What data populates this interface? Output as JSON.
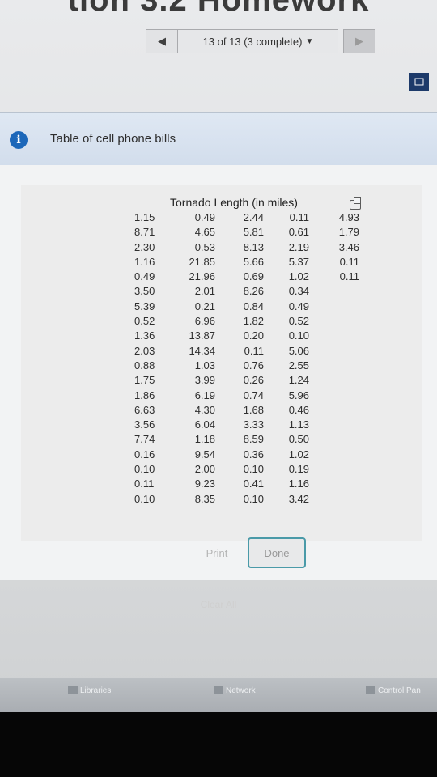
{
  "page": {
    "heading": "tion 3.2 Homework"
  },
  "navigation": {
    "progress_label": "13 of 13 (3 complete)",
    "caret": "▼",
    "prev_glyph": "◀",
    "next_glyph": "▶"
  },
  "dialog": {
    "icon": "info-icon",
    "title": "Table of cell phone bills",
    "table_title": "Tornado Length (in miles)",
    "rows": [
      [
        "1.15",
        "0.49",
        "2.44",
        "0.11",
        "4.93"
      ],
      [
        "8.71",
        "4.65",
        "5.81",
        "0.61",
        "1.79"
      ],
      [
        "2.30",
        "0.53",
        "8.13",
        "2.19",
        "3.46"
      ],
      [
        "1.16",
        "21.85",
        "5.66",
        "5.37",
        "0.11"
      ],
      [
        "0.49",
        "21.96",
        "0.69",
        "1.02",
        "0.11"
      ],
      [
        "3.50",
        "2.01",
        "8.26",
        "0.34",
        ""
      ],
      [
        "5.39",
        "0.21",
        "0.84",
        "0.49",
        ""
      ],
      [
        "0.52",
        "6.96",
        "1.82",
        "0.52",
        ""
      ],
      [
        "1.36",
        "13.87",
        "0.20",
        "0.10",
        ""
      ],
      [
        "2.03",
        "14.34",
        "0.11",
        "5.06",
        ""
      ],
      [
        "0.88",
        "1.03",
        "0.76",
        "2.55",
        ""
      ],
      [
        "1.75",
        "3.99",
        "0.26",
        "1.24",
        ""
      ],
      [
        "1.86",
        "6.19",
        "0.74",
        "5.96",
        ""
      ],
      [
        "6.63",
        "4.30",
        "1.68",
        "0.46",
        ""
      ],
      [
        "3.56",
        "6.04",
        "3.33",
        "1.13",
        ""
      ],
      [
        "7.74",
        "1.18",
        "8.59",
        "0.50",
        ""
      ],
      [
        "0.16",
        "9.54",
        "0.36",
        "1.02",
        ""
      ],
      [
        "0.10",
        "2.00",
        "0.10",
        "0.19",
        ""
      ],
      [
        "0.11",
        "9.23",
        "0.41",
        "1.16",
        ""
      ],
      [
        "0.10",
        "8.35",
        "0.10",
        "3.42",
        ""
      ]
    ],
    "print_label": "Print",
    "done_label": "Done"
  },
  "clear_all_label": "Clear All",
  "taskbar": {
    "items": [
      "Libraries",
      "Network",
      "Control Pan"
    ]
  },
  "colors": {
    "info_blue": "#1c67b9",
    "done_border": "#4a9aa8",
    "header_bg": "#d2ddec"
  }
}
